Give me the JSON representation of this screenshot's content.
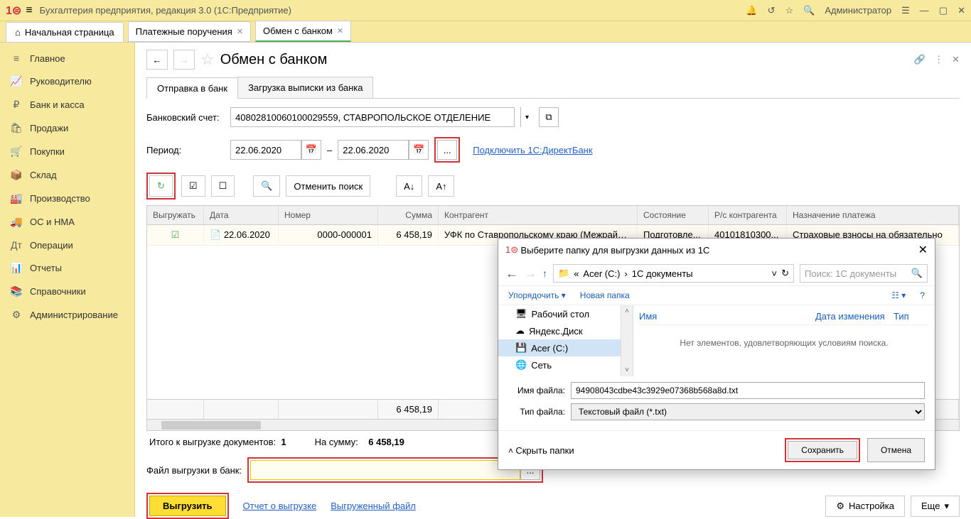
{
  "title": "Бухгалтерия предприятия, редакция 3.0  (1С:Предприятие)",
  "user": "Администратор",
  "start_tab": "Начальная страница",
  "doc_tabs": [
    {
      "label": "Платежные поручения"
    },
    {
      "label": "Обмен с банком",
      "active": true
    }
  ],
  "sidebar": [
    {
      "icon": "≡",
      "label": "Главное"
    },
    {
      "icon": "📈",
      "label": "Руководителю"
    },
    {
      "icon": "₽",
      "label": "Банк и касса"
    },
    {
      "icon": "🛍",
      "label": "Продажи"
    },
    {
      "icon": "🛒",
      "label": "Покупки"
    },
    {
      "icon": "📦",
      "label": "Склад"
    },
    {
      "icon": "🏭",
      "label": "Производство"
    },
    {
      "icon": "🚚",
      "label": "ОС и НМА"
    },
    {
      "icon": "Дт",
      "label": "Операции"
    },
    {
      "icon": "📊",
      "label": "Отчеты"
    },
    {
      "icon": "📚",
      "label": "Справочники"
    },
    {
      "icon": "⚙",
      "label": "Администрирование"
    }
  ],
  "page": {
    "title": "Обмен с банком",
    "tabs": [
      {
        "label": "Отправка в банк",
        "active": true
      },
      {
        "label": "Загрузка выписки из банка"
      }
    ],
    "bank_account_label": "Банковский счет:",
    "bank_account": "40802810060100029559, СТАВРОПОЛЬСКОЕ ОТДЕЛЕНИЕ",
    "period_label": "Период:",
    "date_from": "22.06.2020",
    "date_sep": "–",
    "date_to": "22.06.2020",
    "ellipsis": "...",
    "direct_link": "Подключить 1С:ДиректБанк",
    "cancel_search": "Отменить поиск",
    "table": {
      "headers": [
        "Выгружать",
        "Дата",
        "Номер",
        "Сумма",
        "Контрагент",
        "Состояние",
        "Р/с контрагента",
        "Назначение платежа"
      ],
      "row": {
        "date": "22.06.2020",
        "number": "0000-000001",
        "sum": "6 458,19",
        "contragent": "УФК по Ставропольскому краю (Межрайон...",
        "state": "Подготовле...",
        "rs": "40101810300...",
        "purpose": "Страховые взносы на обязательно"
      },
      "footer_sum": "6 458,19"
    },
    "summary_docs_label": "Итого к выгрузке документов:",
    "summary_docs": "1",
    "summary_sum_label": "На сумму:",
    "summary_sum": "6 458,19",
    "file_label": "Файл выгрузки в банк:",
    "upload_btn": "Выгрузить",
    "report_link": "Отчет о выгрузке",
    "file_link": "Выгруженный файл",
    "settings_btn": "Настройка",
    "more_btn": "Еще"
  },
  "dialog": {
    "title": "Выберите папку для выгрузки данных из 1С",
    "breadcrumb": [
      "Acer (C:)",
      "1С документы"
    ],
    "search_placeholder": "Поиск: 1С документы",
    "organize": "Упорядочить",
    "new_folder": "Новая папка",
    "tree": [
      "Рабочий стол",
      "Яндекс.Диск",
      "Acer (C:)",
      "Сеть"
    ],
    "files_cols": [
      "Имя",
      "Дата изменения",
      "Тип"
    ],
    "no_items": "Нет элементов, удовлетворяющих условиям поиска.",
    "filename_label": "Имя файла:",
    "filename": "94908043cdbe43c3929e07368b568a8d.txt",
    "filetype_label": "Тип файла:",
    "filetype": "Текстовый файл (*.txt)",
    "hide_folders": "Скрыть папки",
    "save_btn": "Сохранить",
    "cancel_btn": "Отмена"
  }
}
